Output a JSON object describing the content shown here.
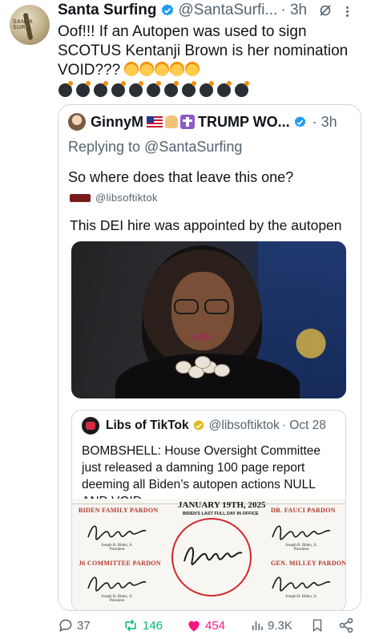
{
  "post": {
    "author_name": "Santa Surfing",
    "author_handle": "@SantaSurfi...",
    "time": "· 3h",
    "avatar_text": "SANTA SURF",
    "text": "Oof!!! If an Autopen was used to sign SCOTUS Kentanji Brown is her nomination VOID???",
    "party_emoji_count": 5,
    "bomb_emoji_count": 11
  },
  "quote": {
    "author_name": "GinnyM",
    "author_name_suffix": "TRUMP WO...",
    "time": "· 3h",
    "replying": "Replying to @SantaSurfing",
    "text": "So where does that leave this one?",
    "inner": {
      "cut_handle": "@libsoftiktok",
      "text": "This DEI hire was appointed by the autopen",
      "nested": {
        "author_name": "Libs of TikTok",
        "author_handle": "@libsoftiktok",
        "time": "· Oct 28",
        "text": "BOMBSHELL: House Oversight Committee just released a damning 100 page report deeming all Biden’s autopen actions NULL AND VOID",
        "document": {
          "date": "JANUARY 19TH, 2025",
          "subtitle": "BIDEN'S LAST FULL DAY IN OFFICE",
          "labels": [
            "BIDEN FAMILY PARDON",
            "DR. FAUCI PARDON",
            "J6 COMMITTEE PARDON",
            "GEN. MILLEY PARDON"
          ],
          "sig_caption": "Joseph R. Biden, Jr.",
          "sig_role": "President"
        }
      }
    }
  },
  "actions": {
    "replies": "37",
    "reposts": "146",
    "likes": "454",
    "views": "9.3K"
  },
  "colors": {
    "verified_blue": "#1d9bf0",
    "verified_gold": "#e2b719",
    "repost_green": "#00ba7c",
    "like_pink": "#f91880",
    "muted": "#536471"
  }
}
